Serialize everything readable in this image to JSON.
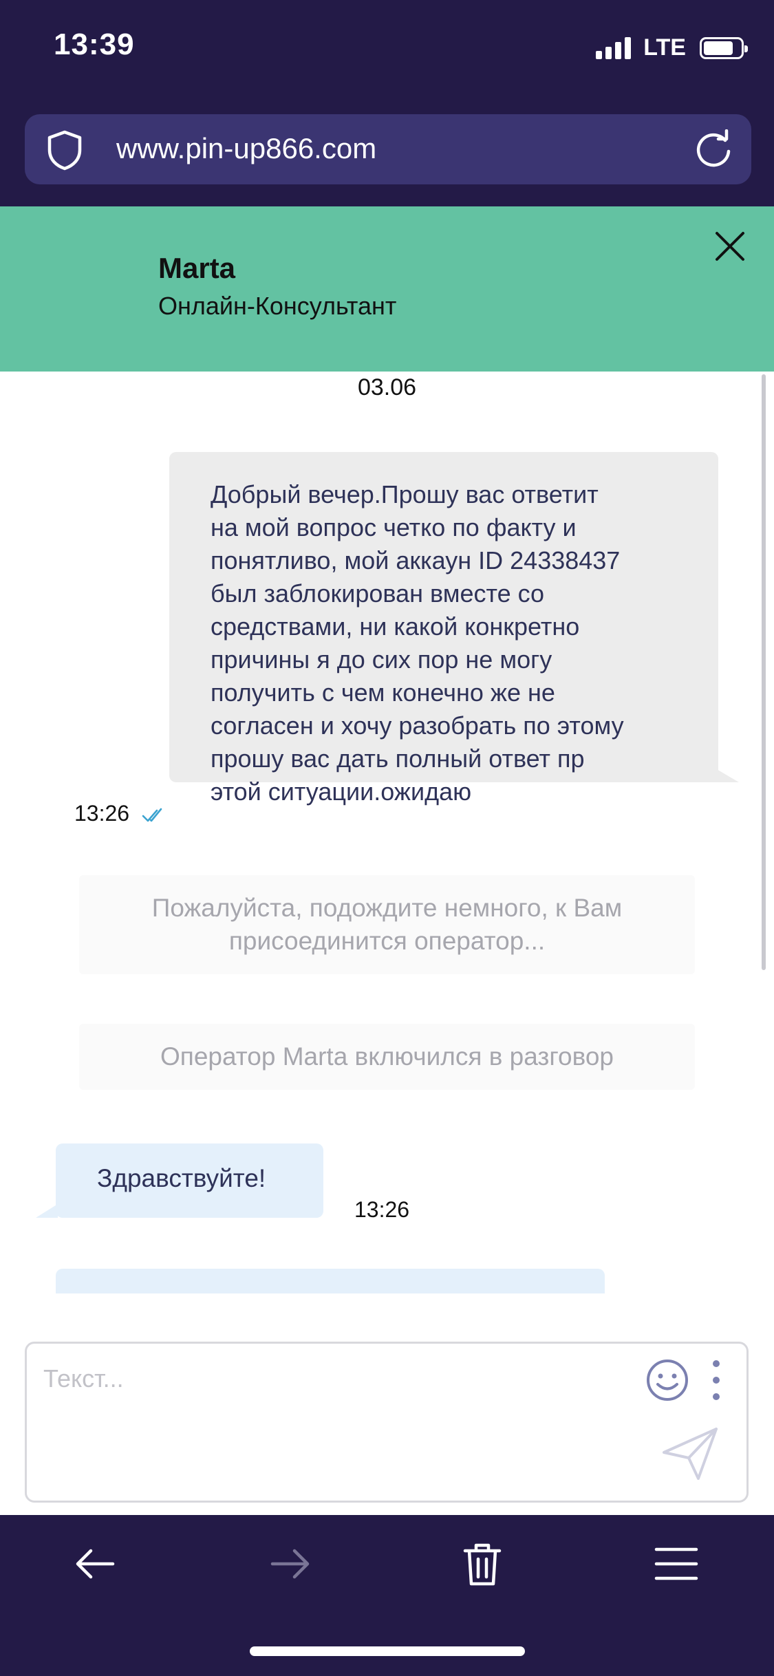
{
  "status_bar": {
    "time": "13:39",
    "network": "LTE",
    "battery_level": 0.8
  },
  "browser": {
    "url": "www.pin-up866.com"
  },
  "chat_header": {
    "agent_name": "Marta",
    "agent_role": "Онлайн-Консультант"
  },
  "messages": {
    "date": "03.06",
    "outgoing": {
      "lines": [
        "Добрый вечер.Прошу вас ответит",
        "на мой вопрос четко по факту и",
        "понятливо, мой аккаун ID 24338437",
        "был заблокирован вместе со",
        "средствами, ни какой конкретно",
        "причины я до сих пор не могу",
        "получить с чем конечно же не",
        "согласен и хочу разобрать по этому",
        "прошу вас дать полный ответ пр",
        "этой ситуации.ожидаю"
      ],
      "time": "13:26"
    },
    "system_wait": [
      "Пожалуйста, подождите немного, к Вам",
      "присоединится оператор..."
    ],
    "system_joined": "Оператор Marta включился в разговор",
    "incoming": {
      "text": "Здравствуйте!",
      "time": "13:26"
    }
  },
  "composer": {
    "placeholder": "Текст..."
  },
  "colors": {
    "dark_bar": "#231a47",
    "url_bar": "#3b3572",
    "header_green": "#63c2a2",
    "incoming_bubble": "#e4f0fb",
    "outgoing_bubble": "#ececec"
  }
}
